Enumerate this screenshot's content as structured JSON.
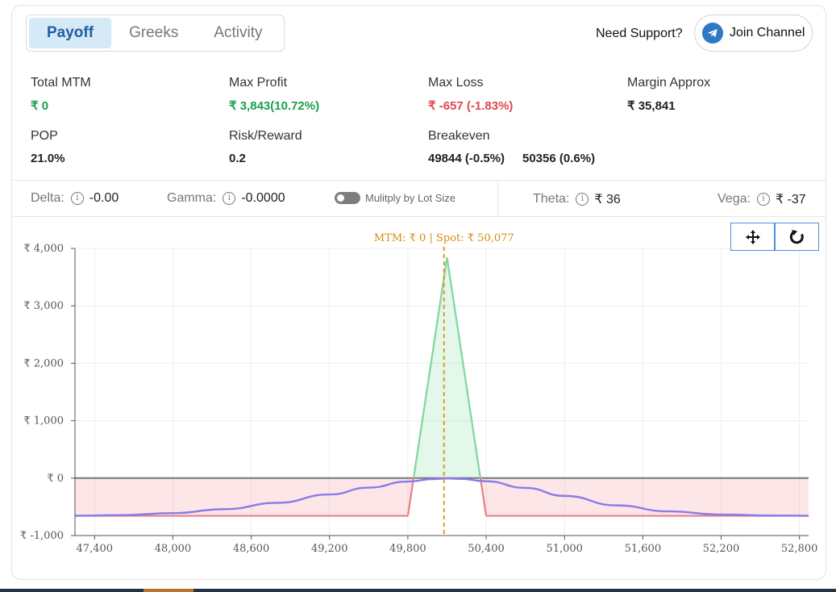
{
  "tabs": [
    {
      "label": "Payoff",
      "active": true
    },
    {
      "label": "Greeks",
      "active": false
    },
    {
      "label": "Activity",
      "active": false
    }
  ],
  "support": {
    "text": "Need Support?",
    "join_label": "Join Channel"
  },
  "stats": {
    "total_mtm": {
      "label": "Total MTM",
      "value": "₹ 0"
    },
    "max_profit": {
      "label": "Max Profit",
      "value": "₹ 3,843(10.72%)"
    },
    "max_loss": {
      "label": "Max Loss",
      "value": "₹ -657 (-1.83%)"
    },
    "margin": {
      "label": "Margin Approx",
      "value": "₹ 35,841"
    },
    "pop": {
      "label": "POP",
      "value": "21.0%"
    },
    "risk_reward": {
      "label": "Risk/Reward",
      "value": "0.2"
    },
    "breakeven": {
      "label": "Breakeven",
      "values": [
        "49844 (-0.5%)",
        "50356 (0.6%)"
      ]
    }
  },
  "greeks": {
    "delta": {
      "label": "Delta:",
      "value": "-0.00"
    },
    "gamma": {
      "label": "Gamma:",
      "value": "-0.0000"
    },
    "multiply_label": "Mulitply by Lot Size",
    "multiply_on": false,
    "theta": {
      "label": "Theta:",
      "value": "₹ 36"
    },
    "vega": {
      "label": "Vega:",
      "value": "₹ -37"
    }
  },
  "colors": {
    "accent": "#1f5fa3",
    "profit": "#19a04a",
    "loss": "#e0474c",
    "spot_line": "#e39a1d",
    "theoretical": "#8a7be6"
  },
  "icons": {
    "move": "move-icon",
    "reset": "refresh-icon",
    "telegram": "telegram-icon",
    "info": "info-icon"
  },
  "chart_data": {
    "type": "line",
    "title": "MTM: ₹ 0  |  Spot: ₹ 50,077",
    "spot": 50077,
    "xlim": [
      47250,
      52870
    ],
    "ylim": [
      -1000,
      4000
    ],
    "x_ticks": [
      47400,
      48000,
      48600,
      49200,
      49800,
      50400,
      51000,
      51600,
      52200,
      52800
    ],
    "x_tick_labels": [
      "47,400",
      "48,000",
      "48,600",
      "49,200",
      "49,800",
      "50,400",
      "51,000",
      "51,600",
      "52,200",
      "52,800"
    ],
    "y_ticks": [
      4000,
      3000,
      2000,
      1000,
      0,
      -1000
    ],
    "y_tick_labels": [
      "₹ 4,000",
      "₹ 3,000",
      "₹ 2,000",
      "₹ 1,000",
      "₹ 0",
      "₹ -1,000"
    ],
    "series": [
      {
        "role": "expiry_payoff",
        "x": [
          47250,
          49800,
          49844,
          50100,
          50356,
          50400,
          52870
        ],
        "y": [
          -657,
          -657,
          0,
          3843,
          0,
          -657,
          -657
        ]
      },
      {
        "role": "target_day",
        "x": [
          47250,
          47600,
          48000,
          48400,
          48800,
          49200,
          49500,
          49800,
          50000,
          50100,
          50200,
          50400,
          50700,
          51000,
          51400,
          51800,
          52200,
          52600,
          52870
        ],
        "y": [
          -655,
          -645,
          -610,
          -540,
          -430,
          -285,
          -165,
          -60,
          -15,
          -5,
          -12,
          -55,
          -170,
          -310,
          -475,
          -580,
          -635,
          -652,
          -655
        ]
      },
      {
        "role": "zero_line",
        "x": [
          47250,
          52870
        ],
        "y": [
          0,
          0
        ]
      }
    ]
  }
}
